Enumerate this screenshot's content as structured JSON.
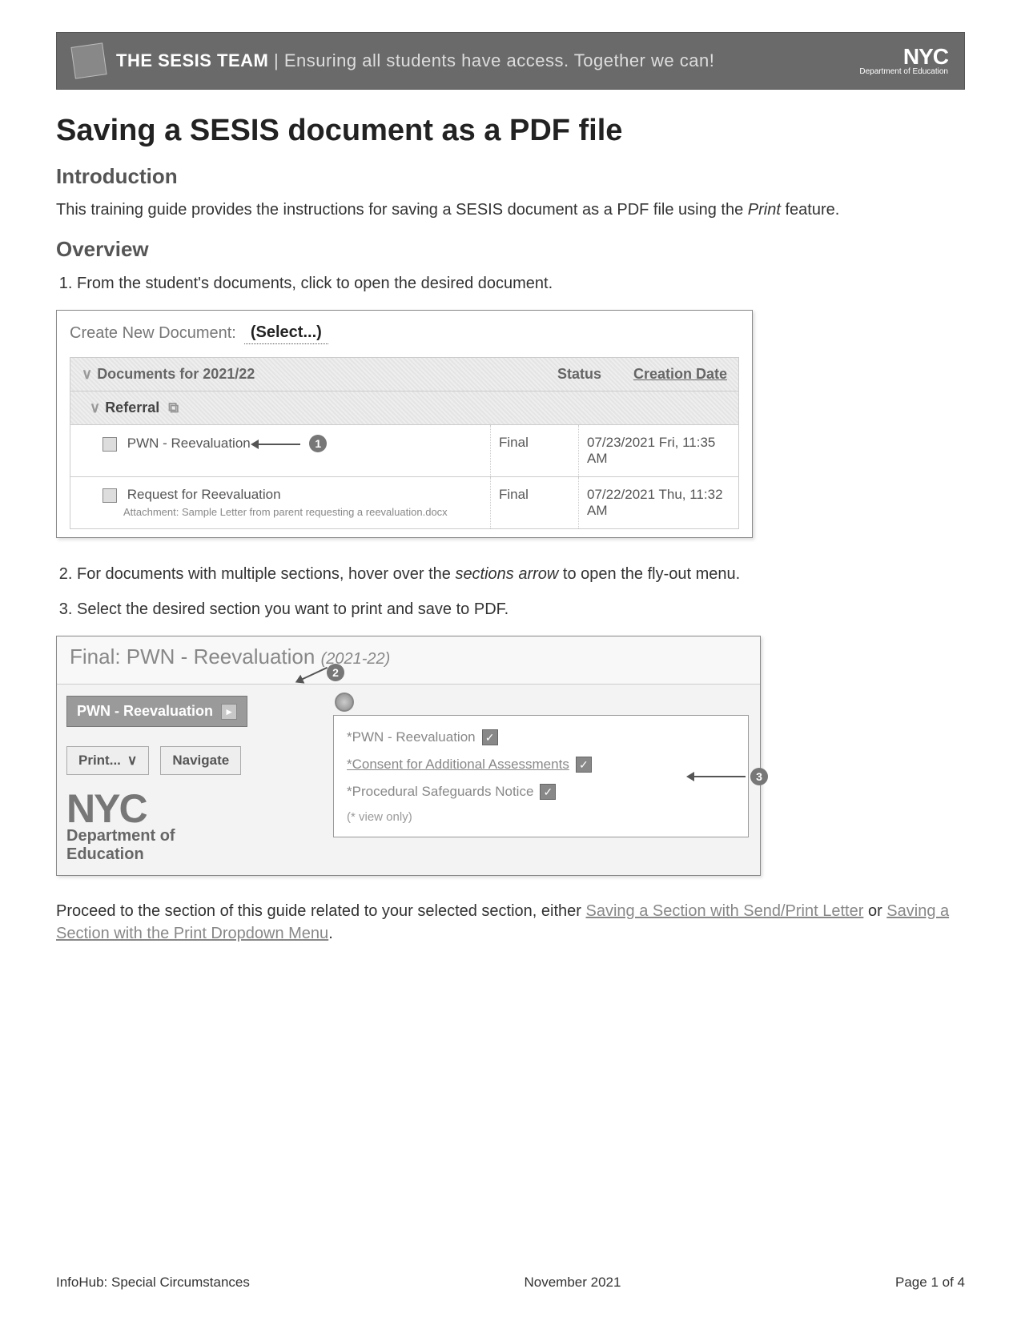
{
  "banner": {
    "team": "THE SESIS TEAM",
    "tagline": "Ensuring all students have access. Together we can!",
    "logo_big": "NYC",
    "logo_small": "Department of Education"
  },
  "title": "Saving a SESIS document as a PDF file",
  "intro_heading": "Introduction",
  "intro_body_a": "This training guide provides the instructions for saving a SESIS document as a PDF file using the ",
  "intro_body_italic": "Print",
  "intro_body_b": " feature.",
  "overview_heading": "Overview",
  "steps": {
    "s1": "From the student's documents, click to open the desired document.",
    "s2_a": "For documents with multiple sections, hover over the ",
    "s2_italic": "sections arrow",
    "s2_b": " to open the fly-out menu.",
    "s3": "Select the desired section you want to print and save to PDF."
  },
  "shot1": {
    "create_label": "Create New Document:",
    "create_value": "(Select...)",
    "col_group": "Documents for 2021/22",
    "col_status": "Status",
    "col_date": "Creation Date",
    "subgroup": "Referral",
    "rows": [
      {
        "name": "PWN - Reevaluation",
        "status": "Final",
        "date": "07/23/2021 Fri, 11:35 AM",
        "marker": "1"
      },
      {
        "name": "Request for Reevaluation",
        "attachment": "Attachment: Sample Letter from parent requesting a reevaluation.docx",
        "status": "Final",
        "date": "07/22/2021 Thu, 11:32 AM"
      }
    ]
  },
  "shot2": {
    "title_prefix": "Final: PWN - Reevaluation",
    "title_year": "(2021-22)",
    "marker2": "2",
    "tab_label": "PWN - Reevaluation",
    "print_label": "Print...",
    "navigate_label": "Navigate",
    "logo_nyc": "NYC",
    "logo_dept1": "Department of",
    "logo_dept2": "Education",
    "flyout": {
      "items": [
        "*PWN - Reevaluation",
        "*Consent for Additional Assessments",
        "*Procedural Safeguards Notice"
      ],
      "note": "(* view only)"
    },
    "marker3": "3"
  },
  "closing_a": "Proceed to the section of this guide related to your selected section, either ",
  "closing_link1": "Saving a Section with Send/Print Letter",
  "closing_mid": " or ",
  "closing_link2": "Saving a Section with the Print Dropdown Menu",
  "closing_end": ".",
  "footer": {
    "left": "InfoHub: Special Circumstances",
    "center": "November 2021",
    "right": "Page 1 of 4"
  }
}
